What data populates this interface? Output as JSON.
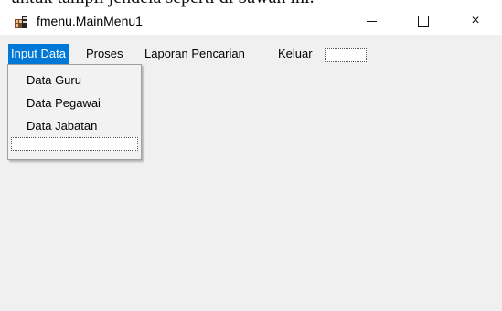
{
  "document_fragment": "untuk tampil jendela seperti di bawah ini.",
  "window": {
    "title": "fmenu.MainMenu1",
    "controls": {
      "minimize_glyph": "—",
      "close_glyph": "×"
    },
    "icon": "app-form-icon"
  },
  "menubar": {
    "items": [
      {
        "label": "Input Data",
        "active": true
      },
      {
        "label": "Proses"
      },
      {
        "label": "Laporan Pencarian"
      },
      {
        "label": "Keluar"
      }
    ]
  },
  "dropdown": {
    "items": [
      {
        "label": "Data Guru"
      },
      {
        "label": "Data Pegawai"
      },
      {
        "label": "Data Jabatan"
      }
    ]
  },
  "colors": {
    "accent": "#0078d7",
    "window_background": "#f0f0f0",
    "menu_background": "#f2f2f2"
  }
}
